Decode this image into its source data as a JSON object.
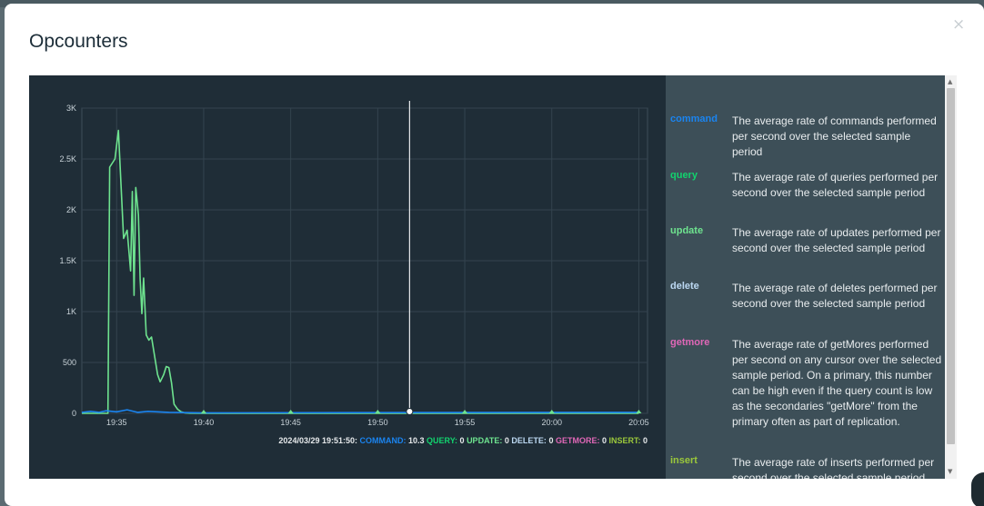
{
  "modal": {
    "title": "Opcounters",
    "close_icon": "×"
  },
  "colors": {
    "command": "#1a84f0",
    "query": "#12d36e",
    "update": "#6ee38f",
    "delete": "#bcd8f2",
    "getmore": "#e067b7",
    "insert": "#9bc83b"
  },
  "chart_data": {
    "type": "line",
    "x": [
      "19:33",
      "19:33.5",
      "19:34",
      "19:34.5",
      "19:34.6",
      "19:34.8",
      "19:35",
      "19:35.2",
      "19:35.4",
      "19:35.6",
      "19:35.8",
      "19:36",
      "19:36.1",
      "19:36.2",
      "19:36.3",
      "19:36.4",
      "19:36.5",
      "19:36.6",
      "19:36.7",
      "19:36.8",
      "19:37",
      "19:37.2",
      "19:37.4",
      "19:37.6",
      "19:37.8",
      "19:38",
      "19:38.2",
      "19:38.4",
      "19:38.6",
      "19:38.8",
      "19:39",
      "19:39.3",
      "19:39.6",
      "19:40",
      "19:45",
      "19:50",
      "19:55",
      "20:00",
      "20:05"
    ],
    "x_ticks": [
      "19:35",
      "19:40",
      "19:45",
      "19:50",
      "19:55",
      "20:00",
      "20:05"
    ],
    "y_ticks": [
      "0",
      "500",
      "1K",
      "1.5K",
      "2K",
      "2.5K",
      "3K"
    ],
    "ylim": [
      0,
      3000
    ],
    "series": [
      {
        "name": "update",
        "color": "#6ee38f",
        "points": [
          [
            0,
            0
          ],
          [
            1.5,
            0
          ],
          [
            1.6,
            2420
          ],
          [
            1.9,
            2500
          ],
          [
            2.1,
            2780
          ],
          [
            2.4,
            1720
          ],
          [
            2.6,
            1800
          ],
          [
            2.8,
            1400
          ],
          [
            2.9,
            2180
          ],
          [
            3.0,
            1160
          ],
          [
            3.1,
            2220
          ],
          [
            3.25,
            1950
          ],
          [
            3.35,
            1320
          ],
          [
            3.45,
            980
          ],
          [
            3.55,
            1330
          ],
          [
            3.7,
            770
          ],
          [
            3.85,
            720
          ],
          [
            4.0,
            750
          ],
          [
            4.2,
            540
          ],
          [
            4.35,
            380
          ],
          [
            4.5,
            310
          ],
          [
            4.7,
            380
          ],
          [
            4.85,
            460
          ],
          [
            5.0,
            450
          ],
          [
            5.15,
            300
          ],
          [
            5.3,
            90
          ],
          [
            5.5,
            40
          ],
          [
            5.7,
            15
          ],
          [
            5.9,
            5
          ],
          [
            6.2,
            2
          ],
          [
            7,
            0
          ],
          [
            32,
            0
          ]
        ]
      },
      {
        "name": "command",
        "color": "#1a84f0",
        "points": [
          [
            0,
            10
          ],
          [
            0.5,
            20
          ],
          [
            1,
            10
          ],
          [
            1.4,
            25
          ],
          [
            2,
            15
          ],
          [
            2.6,
            35
          ],
          [
            3.2,
            10
          ],
          [
            3.8,
            20
          ],
          [
            5,
            10
          ],
          [
            7,
            5
          ],
          [
            32,
            10
          ]
        ]
      }
    ],
    "hover": {
      "time_label": "2024/03/29 19:51:50:",
      "values": [
        {
          "label": "COMMAND:",
          "value": "10.3",
          "color": "#1a84f0"
        },
        {
          "label": "QUERY:",
          "value": "0",
          "color": "#12d36e"
        },
        {
          "label": "UPDATE:",
          "value": "0",
          "color": "#6ee38f"
        },
        {
          "label": "DELETE:",
          "value": "0",
          "color": "#bcd8f2"
        },
        {
          "label": "GETMORE:",
          "value": "0",
          "color": "#e067b7"
        },
        {
          "label": "INSERT:",
          "value": "0",
          "color": "#9bc83b"
        }
      ]
    }
  },
  "legend": [
    {
      "name": "command",
      "description": "The average rate of commands performed per second over the selected sample period",
      "color": "#1a84f0"
    },
    {
      "name": "query",
      "description": "The average rate of queries performed per second over the selected sample period",
      "color": "#12d36e"
    },
    {
      "name": "update",
      "description": "The average rate of updates performed per second over the selected sample period",
      "color": "#6ee38f"
    },
    {
      "name": "delete",
      "description": "The average rate of deletes performed per second over the selected sample period",
      "color": "#bcd8f2"
    },
    {
      "name": "getmore",
      "description": "The average rate of getMores performed per second on any cursor over the selected sample period. On a primary, this number can be high even if the query count is low as the secondaries \"getMore\" from the primary often as part of replication.",
      "color": "#e067b7"
    },
    {
      "name": "insert",
      "description": "The average rate of inserts performed per second over the selected sample period",
      "color": "#9bc83b"
    }
  ]
}
